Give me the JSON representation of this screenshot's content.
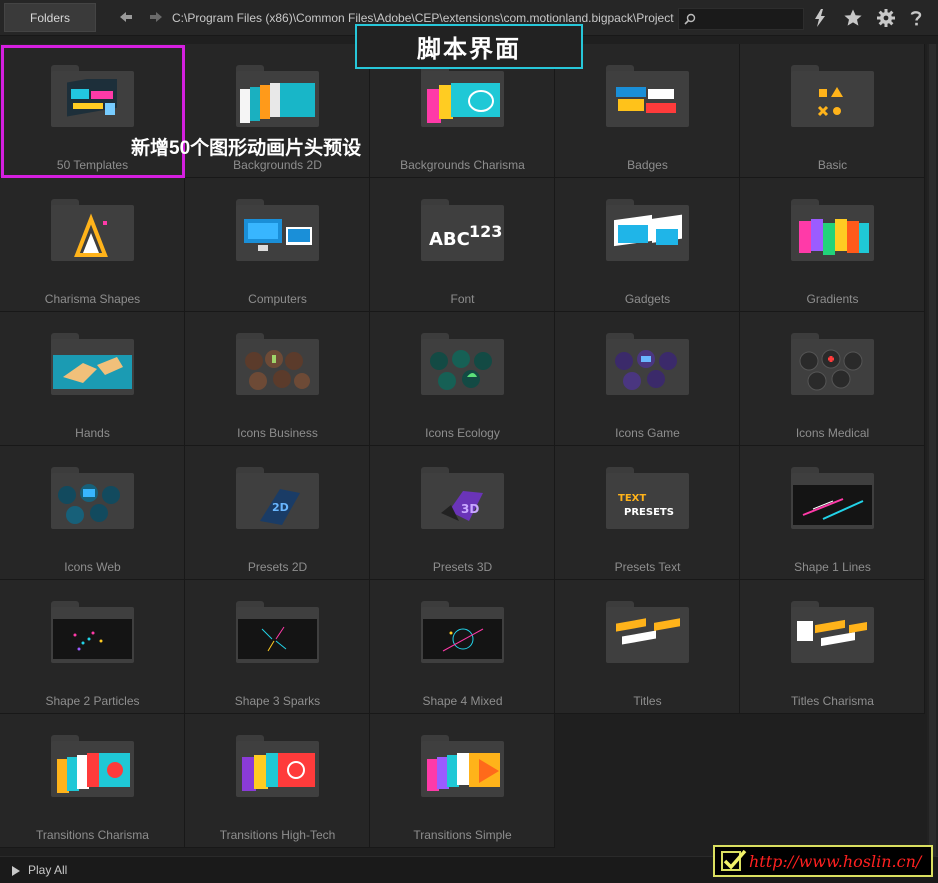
{
  "toolbar": {
    "folders_label": "Folders",
    "path": "C:\\Program Files (x86)\\Common Files\\Adobe\\CEP\\extensions\\com.motionland.bigpack\\Project",
    "search_placeholder": ""
  },
  "banner": "脚本界面",
  "annotation": "新增50个图形动画片头预设",
  "folders": [
    {
      "label": "50 Templates",
      "icon": "templates-thumb"
    },
    {
      "label": "Backgrounds 2D",
      "icon": "backgrounds-2d-thumb"
    },
    {
      "label": "Backgrounds Charisma",
      "icon": "backgrounds-charisma-thumb"
    },
    {
      "label": "Badges",
      "icon": "badges-thumb"
    },
    {
      "label": "Basic",
      "icon": "basic-thumb"
    },
    {
      "label": "Charisma Shapes",
      "icon": "charisma-shapes-thumb"
    },
    {
      "label": "Computers",
      "icon": "computers-thumb"
    },
    {
      "label": "Font",
      "icon": "font-thumb"
    },
    {
      "label": "Gadgets",
      "icon": "gadgets-thumb"
    },
    {
      "label": "Gradients",
      "icon": "gradients-thumb"
    },
    {
      "label": "Hands",
      "icon": "hands-thumb"
    },
    {
      "label": "Icons Business",
      "icon": "icons-business-thumb"
    },
    {
      "label": "Icons Ecology",
      "icon": "icons-ecology-thumb"
    },
    {
      "label": "Icons Game",
      "icon": "icons-game-thumb"
    },
    {
      "label": "Icons Medical",
      "icon": "icons-medical-thumb"
    },
    {
      "label": "Icons Web",
      "icon": "icons-web-thumb"
    },
    {
      "label": "Presets 2D",
      "icon": "presets-2d-thumb"
    },
    {
      "label": "Presets 3D",
      "icon": "presets-3d-thumb"
    },
    {
      "label": "Presets Text",
      "icon": "presets-text-thumb"
    },
    {
      "label": "Shape 1 Lines",
      "icon": "shape-lines-thumb"
    },
    {
      "label": "Shape 2 Particles",
      "icon": "shape-particles-thumb"
    },
    {
      "label": "Shape 3 Sparks",
      "icon": "shape-sparks-thumb"
    },
    {
      "label": "Shape 4 Mixed",
      "icon": "shape-mixed-thumb"
    },
    {
      "label": "Titles",
      "icon": "titles-thumb"
    },
    {
      "label": "Titles Charisma",
      "icon": "titles-charisma-thumb"
    },
    {
      "label": "Transitions Charisma",
      "icon": "transitions-charisma-thumb"
    },
    {
      "label": "Transitions High-Tech",
      "icon": "transitions-hightech-thumb"
    },
    {
      "label": "Transitions Simple",
      "icon": "transitions-simple-thumb"
    }
  ],
  "footer": {
    "play_all_label": "Play All"
  },
  "watermark": "http://www.hoslin.cn/",
  "colors": {
    "annotation_border": "#d51fe0",
    "banner_border": "#27c7d9",
    "watermark_border": "#dadf60",
    "watermark_text": "#ff2020"
  }
}
